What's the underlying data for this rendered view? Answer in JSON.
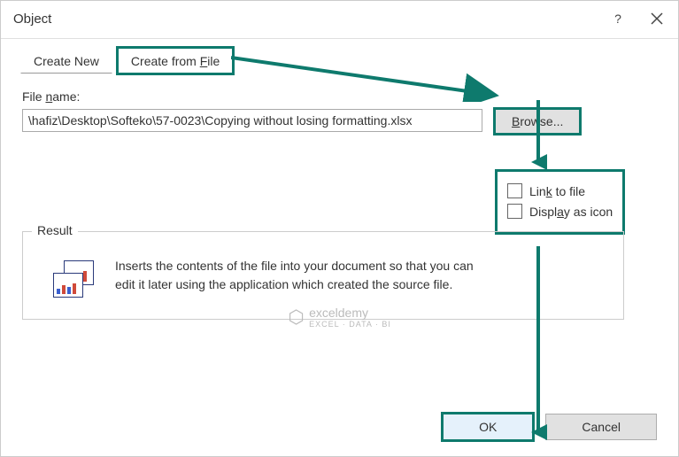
{
  "dialog": {
    "title": "Object"
  },
  "tabs": {
    "create_new": "Create New",
    "create_from_file": "Create from File"
  },
  "file": {
    "label": "File name:",
    "value": "\\hafiz\\Desktop\\Softeko\\57-0023\\Copying without losing formatting.xlsx",
    "browse": "Browse..."
  },
  "options": {
    "link_to_file": "Link to file",
    "display_as_icon": "Display as icon"
  },
  "result": {
    "legend": "Result",
    "description": "Inserts the contents of the file into your document so that you can edit it later using the application which created the source file."
  },
  "buttons": {
    "ok": "OK",
    "cancel": "Cancel"
  },
  "watermark": {
    "brand": "exceldemy",
    "tagline": "EXCEL · DATA · BI"
  }
}
